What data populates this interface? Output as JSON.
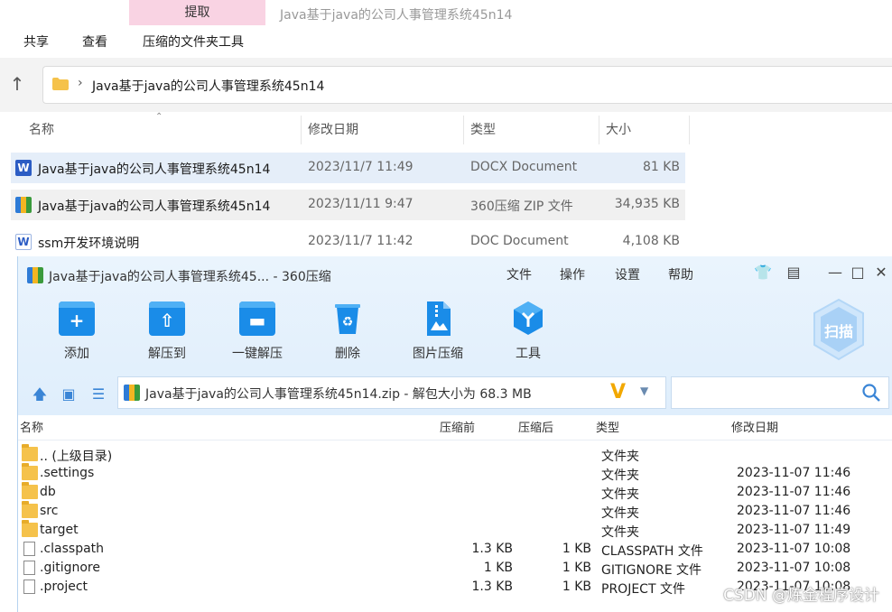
{
  "explorer": {
    "active_tab": "提取",
    "window_title": "Java基于java的公司人事管理系统45n14",
    "ribbon": [
      "共享",
      "查看",
      "压缩的文件夹工具"
    ],
    "address_path": "Java基于java的公司人事管理系统45n14",
    "columns": [
      "名称",
      "修改日期",
      "类型",
      "大小"
    ],
    "files": [
      {
        "name": "Java基于java的公司人事管理系统45n14",
        "date": "2023/11/7 11:49",
        "type": "DOCX Document",
        "size": "81 KB",
        "icon": "word-icon"
      },
      {
        "name": "Java基于java的公司人事管理系统45n14",
        "date": "2023/11/11 9:47",
        "type": "360压缩 ZIP 文件",
        "size": "34,935 KB",
        "icon": "zip-icon"
      },
      {
        "name": "ssm开发环境说明",
        "date": "2023/11/7 11:42",
        "type": "DOC Document",
        "size": "4,108 KB",
        "icon": "word-icon"
      }
    ]
  },
  "zip": {
    "title": "Java基于java的公司人事管理系统45... - 360压缩",
    "menu": [
      "文件",
      "操作",
      "设置",
      "帮助"
    ],
    "tools": [
      "添加",
      "解压到",
      "一键解压",
      "删除",
      "图片压缩",
      "工具"
    ],
    "scan_label": "扫描",
    "path": "Java基于java的公司人事管理系统45n14.zip - 解包大小为 68.3 MB",
    "columns": [
      "名称",
      "压缩前",
      "压缩后",
      "类型",
      "修改日期"
    ],
    "rows": [
      {
        "name": ".. (上级目录)",
        "before": "",
        "after": "",
        "type": "文件夹",
        "date": "",
        "icon": "folder-icon"
      },
      {
        "name": ".settings",
        "before": "",
        "after": "",
        "type": "文件夹",
        "date": "2023-11-07 11:46",
        "icon": "folder-icon"
      },
      {
        "name": "db",
        "before": "",
        "after": "",
        "type": "文件夹",
        "date": "2023-11-07 11:46",
        "icon": "folder-icon"
      },
      {
        "name": "src",
        "before": "",
        "after": "",
        "type": "文件夹",
        "date": "2023-11-07 11:46",
        "icon": "folder-icon"
      },
      {
        "name": "target",
        "before": "",
        "after": "",
        "type": "文件夹",
        "date": "2023-11-07 11:49",
        "icon": "folder-icon"
      },
      {
        "name": ".classpath",
        "before": "1.3 KB",
        "after": "1 KB",
        "type": "CLASSPATH 文件",
        "date": "2023-11-07 10:08",
        "icon": "file-icon"
      },
      {
        "name": ".gitignore",
        "before": "1 KB",
        "after": "1 KB",
        "type": "GITIGNORE 文件",
        "date": "2023-11-07 10:08",
        "icon": "file-icon"
      },
      {
        "name": ".project",
        "before": "1.3 KB",
        "after": "1 KB",
        "type": "PROJECT 文件",
        "date": "2023-11-07 10:08",
        "icon": "file-icon"
      }
    ],
    "watermark": "CSDN @炼金程序设计"
  }
}
